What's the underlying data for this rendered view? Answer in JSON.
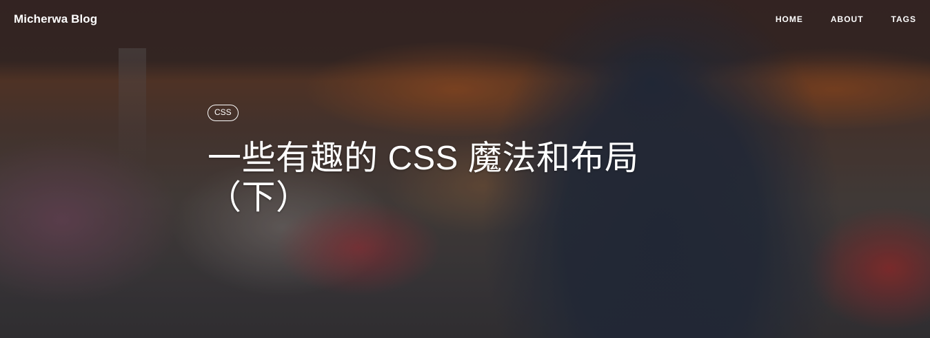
{
  "navbar": {
    "brand": "Micherwa Blog",
    "links": [
      {
        "label": "HOME"
      },
      {
        "label": "ABOUT"
      },
      {
        "label": "TAGS"
      }
    ]
  },
  "post": {
    "tag": "CSS",
    "title": "一些有趣的 CSS 魔法和布局（下）"
  },
  "colors": {
    "text": "#ffffff"
  }
}
